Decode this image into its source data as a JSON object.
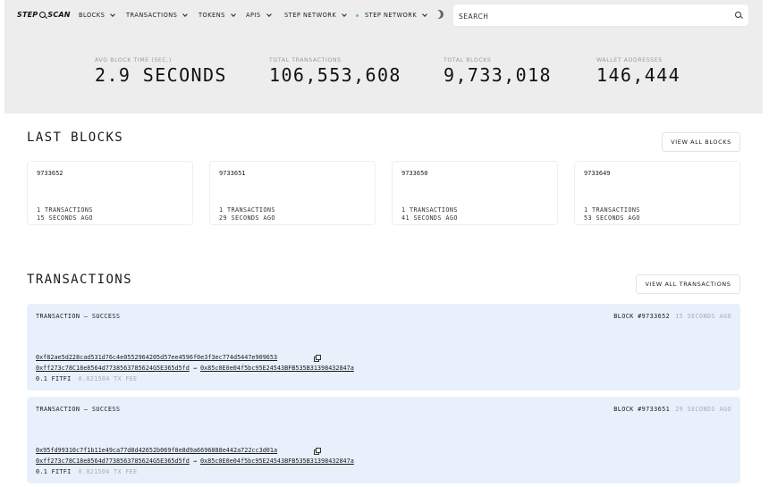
{
  "header": {
    "logo_left": "STEP",
    "logo_right": "SCAN",
    "nav": [
      "BLOCKS",
      "TRANSACTIONS",
      "TOKENS",
      "APIS",
      "STEP NETWORK"
    ],
    "network_selector": "STEP NETWORK",
    "network_status_color": "#62c48e",
    "search_placeholder": "SEARCH"
  },
  "stats": [
    {
      "label": "AVG BLOCK TIME (SEC.)",
      "value": "2.9 SECONDS"
    },
    {
      "label": "TOTAL TRANSACTIONS",
      "value": "106,553,608"
    },
    {
      "label": "TOTAL BLOCKS",
      "value": "9,733,018"
    },
    {
      "label": "WALLET ADDRESSES",
      "value": "146,444"
    }
  ],
  "last_blocks": {
    "title": "LAST BLOCKS",
    "view_all": "VIEW ALL BLOCKS",
    "items": [
      {
        "number": "9733652",
        "transactions": "1 TRANSACTIONS",
        "ago": "15 SECONDS AGO"
      },
      {
        "number": "9733651",
        "transactions": "1 TRANSACTIONS",
        "ago": "29 SECONDS AGO"
      },
      {
        "number": "9733650",
        "transactions": "1 TRANSACTIONS",
        "ago": "41 SECONDS AGO"
      },
      {
        "number": "9733649",
        "transactions": "1 TRANSACTIONS",
        "ago": "53 SECONDS AGO"
      }
    ]
  },
  "transactions": {
    "title": "TRANSACTIONS",
    "view_all": "VIEW ALL TRANSACTIONS",
    "items": [
      {
        "status": "TRANSACTION — SUCCESS",
        "block": "BLOCK #9733652",
        "ago": "15 SECONDS AGO",
        "hash": "0xf82ae5d228cad531d76c4e0552964205d57ee4596f0e3f3ec774d5447e909653",
        "from": "0xff273c78C18e8564d7738563785624G5E365d5fd",
        "to": "0x85c0E0e04f5bc95E24543BFB535B31398432847a",
        "amount": "0.1 FITFI",
        "fee": "0.021504 TX FEE"
      },
      {
        "status": "TRANSACTION — SUCCESS",
        "block": "BLOCK #9733651",
        "ago": "29 SECONDS AGO",
        "hash": "0x95fd99310c7f1b11e49ca77d8d42652b069f8e8d9a6696888e442a722cc3d01a",
        "from": "0xff273c78C18e8564d7738563785624G5E365d5fd",
        "to": "0x85c0E0e04f5bc95E24543BFB535B31398432847a",
        "amount": "0.1 FITFI",
        "fee": "0.021504 TX FEE"
      }
    ]
  }
}
